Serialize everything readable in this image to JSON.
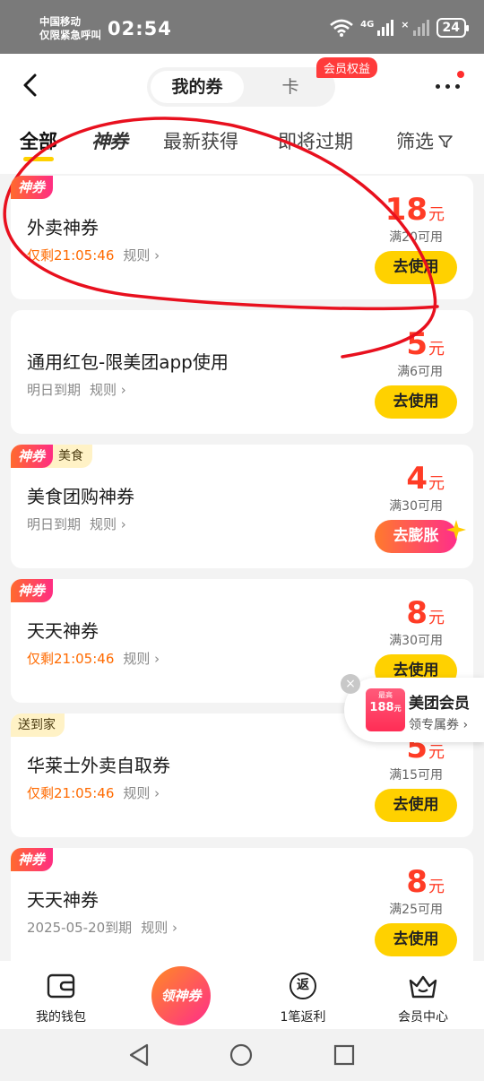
{
  "status_bar": {
    "carrier_line1": "中国移动",
    "carrier_line2": "仅限紧急呼叫",
    "time": "02:54",
    "network": "4G",
    "battery": "24"
  },
  "header": {
    "segments": [
      "我的券",
      "卡"
    ],
    "vip_badge": "会员权益"
  },
  "tabs": [
    {
      "label": "全部",
      "active": true
    },
    {
      "label": "神券",
      "active": false
    },
    {
      "label": "最新获得",
      "active": false
    },
    {
      "label": "即将过期",
      "active": false
    },
    {
      "label": "筛选",
      "active": false
    }
  ],
  "coupons": [
    {
      "tag": "神券",
      "title": "外卖神券",
      "expiry": "仅剩21:05:46",
      "rule": "规则",
      "amount": "18",
      "unit": "元",
      "condition": "满20可用",
      "button": "去使用"
    },
    {
      "tag": "",
      "title": "通用红包-限美团app使用",
      "expiry": "明日到期",
      "rule": "规则",
      "amount": "5",
      "unit": "元",
      "condition": "满6可用",
      "button": "去使用"
    },
    {
      "tag": "神券",
      "category": "美食",
      "title": "美食团购神券",
      "expiry": "明日到期",
      "rule": "规则",
      "amount": "4",
      "unit": "元",
      "condition": "满30可用",
      "button": "去膨胀"
    },
    {
      "tag": "神券",
      "title": "天天神券",
      "expiry": "仅剩21:05:46",
      "rule": "规则",
      "amount": "8",
      "unit": "元",
      "condition": "满30可用",
      "button": "去使用"
    },
    {
      "tag_plain": "送到家",
      "title": "华莱士外卖自取券",
      "expiry": "仅剩21:05:46",
      "rule": "规则",
      "amount": "5",
      "unit": "元",
      "condition": "满15可用",
      "button": "去使用"
    },
    {
      "tag": "神券",
      "title": "天天神券",
      "expiry": "2025-05-20到期",
      "rule": "规则",
      "amount": "8",
      "unit": "元",
      "condition": "满25可用",
      "button": "去使用"
    }
  ],
  "vip_float": {
    "badge_top": "最高",
    "badge_value": "188",
    "badge_unit": "元",
    "title": "美团会员",
    "subtitle": "领专属券"
  },
  "bottom_nav": {
    "wallet": "我的钱包",
    "center": "领神券",
    "cashback_icon": "返",
    "cashback": "1笔返利",
    "member": "会员中心"
  },
  "colors": {
    "accent_yellow": "#ffd100",
    "price_red": "#ff3c26",
    "urgent_orange": "#ff6a00",
    "annotation_red": "#e8101e"
  }
}
